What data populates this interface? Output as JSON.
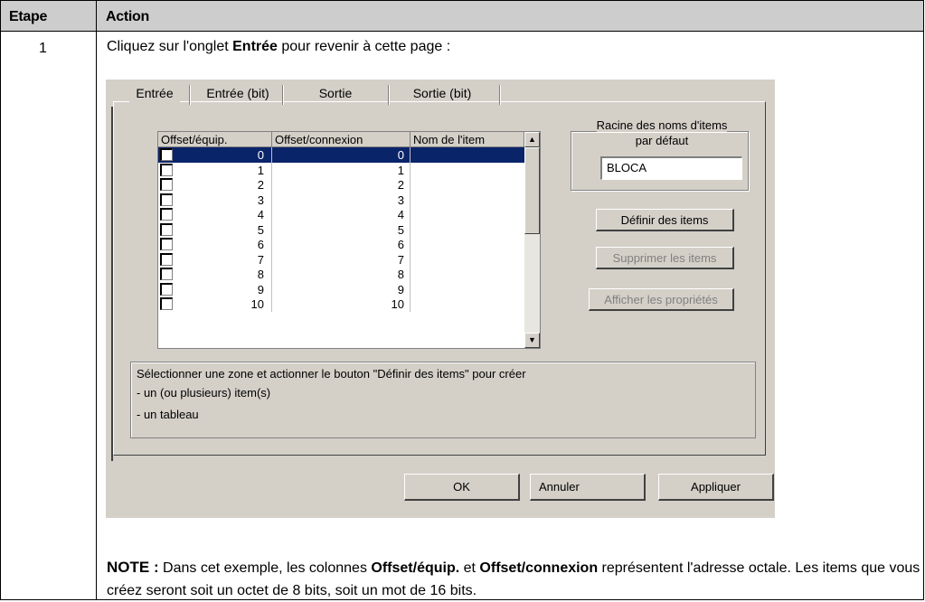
{
  "table": {
    "col_etape": "Etape",
    "col_action": "Action",
    "step_number": "1",
    "instruction_pre": "Cliquez sur l'onglet ",
    "instruction_bold": "Entrée",
    "instruction_post": " pour revenir à cette page :"
  },
  "dialog": {
    "tabs": [
      "Entrée",
      "Entrée (bit)",
      "Sortie",
      "Sortie (bit)"
    ],
    "grid": {
      "headers": [
        "Offset/équip.",
        "Offset/connexion",
        "Nom de l'item"
      ],
      "rows": [
        {
          "offset_equip": "0",
          "offset_conn": "0",
          "name": ""
        },
        {
          "offset_equip": "1",
          "offset_conn": "1",
          "name": ""
        },
        {
          "offset_equip": "2",
          "offset_conn": "2",
          "name": ""
        },
        {
          "offset_equip": "3",
          "offset_conn": "3",
          "name": ""
        },
        {
          "offset_equip": "4",
          "offset_conn": "4",
          "name": ""
        },
        {
          "offset_equip": "5",
          "offset_conn": "5",
          "name": ""
        },
        {
          "offset_equip": "6",
          "offset_conn": "6",
          "name": ""
        },
        {
          "offset_equip": "7",
          "offset_conn": "7",
          "name": ""
        },
        {
          "offset_equip": "8",
          "offset_conn": "8",
          "name": ""
        },
        {
          "offset_equip": "9",
          "offset_conn": "9",
          "name": ""
        },
        {
          "offset_equip": "10",
          "offset_conn": "10",
          "name": ""
        }
      ],
      "selected_row": 0,
      "scroll_up": "▲",
      "scroll_down": "▼"
    },
    "default_root": {
      "title_line1": "Racine des noms d'items",
      "title_line2": "par défaut",
      "value": "BLOCA"
    },
    "buttons": {
      "define": "Définir des items",
      "delete": "Supprimer les items",
      "properties": "Afficher les propriétés",
      "ok": "OK",
      "cancel": "Annuler",
      "apply": "Appliquer"
    },
    "info": {
      "line1": "Sélectionner une zone et actionner le bouton \"Définir des items\" pour créer",
      "line2": "- un (ou plusieurs) item(s)",
      "line3": "- un tableau"
    }
  },
  "note": {
    "label": "NOTE :",
    "t1": " Dans cet exemple, les colonnes ",
    "b1": "Offset/équip.",
    "t2": " et ",
    "b2": "Offset/connexion",
    "t3": " représentent l'adresse octale. Les items que vous créez seront soit un octet de 8 bits, soit un mot de 16 bits."
  }
}
